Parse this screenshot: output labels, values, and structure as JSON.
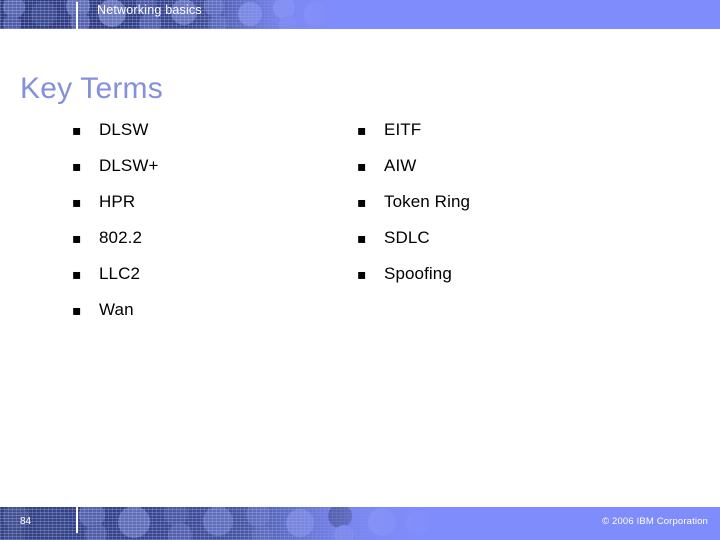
{
  "header": {
    "title": "Networking basics",
    "band_color": "#7f8cfb",
    "deco_dark_color": "#2e3a7a",
    "divider_color": "#ffffff"
  },
  "slide": {
    "title": "Key Terms",
    "title_color": "#8490db",
    "background": "#ffffff"
  },
  "content": {
    "bullet_glyph": "▪",
    "text_color": "#000000",
    "left_column": [
      {
        "label": "DLSW"
      },
      {
        "label": "DLSW+"
      },
      {
        "label": "HPR"
      },
      {
        "label": "802.2"
      },
      {
        "label": "LLC2"
      },
      {
        "label": "Wan"
      }
    ],
    "right_column": [
      {
        "label": "EITF"
      },
      {
        "label": "AIW"
      },
      {
        "label": "Token Ring"
      },
      {
        "label": "SDLC"
      },
      {
        "label": "Spoofing"
      }
    ]
  },
  "footer": {
    "page_number": "84",
    "copyright": "© 2006 IBM Corporation",
    "band_color": "#7f8cfb",
    "text_color": "#ffffff"
  }
}
